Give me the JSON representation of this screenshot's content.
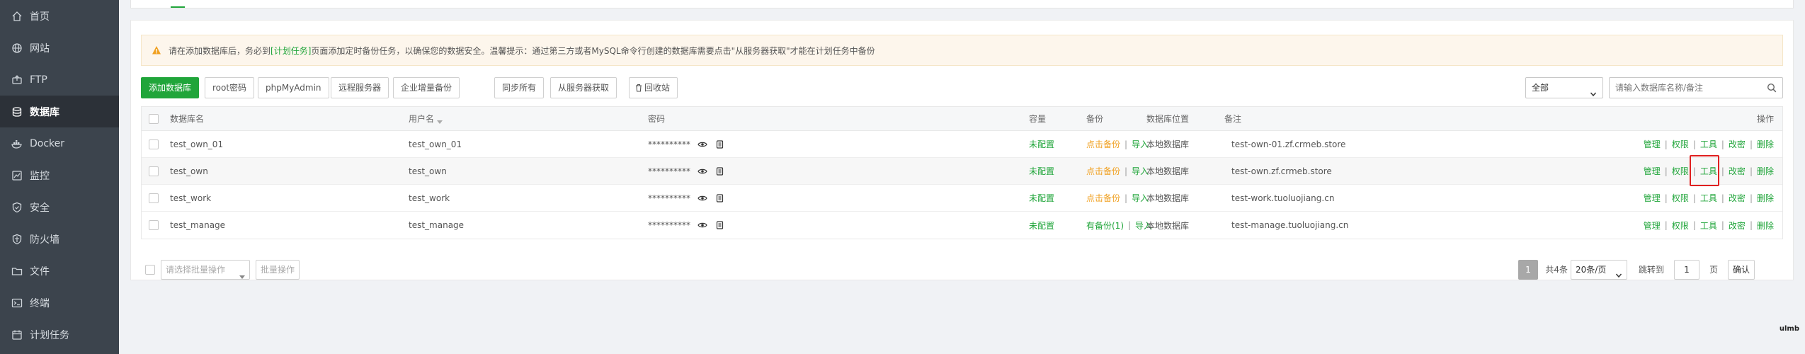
{
  "sidebar": {
    "items": [
      {
        "label": "首页",
        "icon": "home-icon"
      },
      {
        "label": "网站",
        "icon": "globe-icon"
      },
      {
        "label": "FTP",
        "icon": "ftp-icon"
      },
      {
        "label": "数据库",
        "icon": "database-icon",
        "active": true
      },
      {
        "label": "Docker",
        "icon": "docker-icon"
      },
      {
        "label": "监控",
        "icon": "monitor-icon"
      },
      {
        "label": "安全",
        "icon": "shield-icon"
      },
      {
        "label": "防火墙",
        "icon": "firewall-icon"
      },
      {
        "label": "文件",
        "icon": "folder-icon"
      },
      {
        "label": "终端",
        "icon": "terminal-icon"
      },
      {
        "label": "计划任务",
        "icon": "calendar-icon"
      }
    ]
  },
  "alert": {
    "prefix": "请在添加数据库后，务必到",
    "link": "[计划任务]",
    "suffix": "页面添加定时备份任务，以确保您的数据安全。温馨提示：通过第三方或者MySQL命令行创建的数据库需要点击\"从服务器获取\"才能在计划任务中备份"
  },
  "toolbar": {
    "add_db": "添加数据库",
    "root_pwd": "root密码",
    "phpmyadmin": "phpMyAdmin",
    "remote_server": "远程服务器",
    "enterprise_backup": "企业增量备份",
    "sync_all": "同步所有",
    "fetch_from_server": "从服务器获取",
    "recycle_bin": "回收站",
    "filter_select": "全部",
    "search_placeholder": "请输入数据库名称/备注"
  },
  "table": {
    "headers": {
      "name": "数据库名",
      "user": "用户名",
      "password": "密码",
      "capacity": "容量",
      "backup": "备份",
      "location": "数据库位置",
      "remark": "备注",
      "actions": "操作"
    },
    "rows": [
      {
        "name": "test_own_01",
        "user": "test_own_01",
        "password": "**********",
        "capacity": "未配置",
        "backup": "点击备份",
        "backup_state": "none",
        "import": "导入",
        "location": "本地数据库",
        "remark": "test-own-01.zf.crmeb.store"
      },
      {
        "name": "test_own",
        "user": "test_own",
        "password": "**********",
        "capacity": "未配置",
        "backup": "点击备份",
        "backup_state": "none",
        "import": "导入",
        "location": "本地数据库",
        "remark": "test-own.zf.crmeb.store"
      },
      {
        "name": "test_work",
        "user": "test_work",
        "password": "**********",
        "capacity": "未配置",
        "backup": "点击备份",
        "backup_state": "none",
        "import": "导入",
        "location": "本地数据库",
        "remark": "test-work.tuoluojiang.cn"
      },
      {
        "name": "test_manage",
        "user": "test_manage",
        "password": "**********",
        "capacity": "未配置",
        "backup": "有备份(1)",
        "backup_state": "has",
        "import": "导入",
        "location": "本地数据库",
        "remark": "test-manage.tuoluojiang.cn"
      }
    ],
    "actions": {
      "manage": "管理",
      "perm": "权限",
      "tools": "工具",
      "changepwd": "改密",
      "delete": "删除"
    }
  },
  "footer": {
    "batch_placeholder": "请选择批量操作",
    "batch_btn": "批量操作",
    "page_current": "1",
    "total": "共4条",
    "per_page": "20条/页",
    "jump_label": "跳转到",
    "jump_value": "1",
    "page_unit": "页",
    "confirm": "确认"
  },
  "watermark": "ulmb",
  "colors": {
    "accent": "#20a53a",
    "sidebar": "#3c444d",
    "highlight": "#e02020",
    "warning": "#f0a020"
  }
}
